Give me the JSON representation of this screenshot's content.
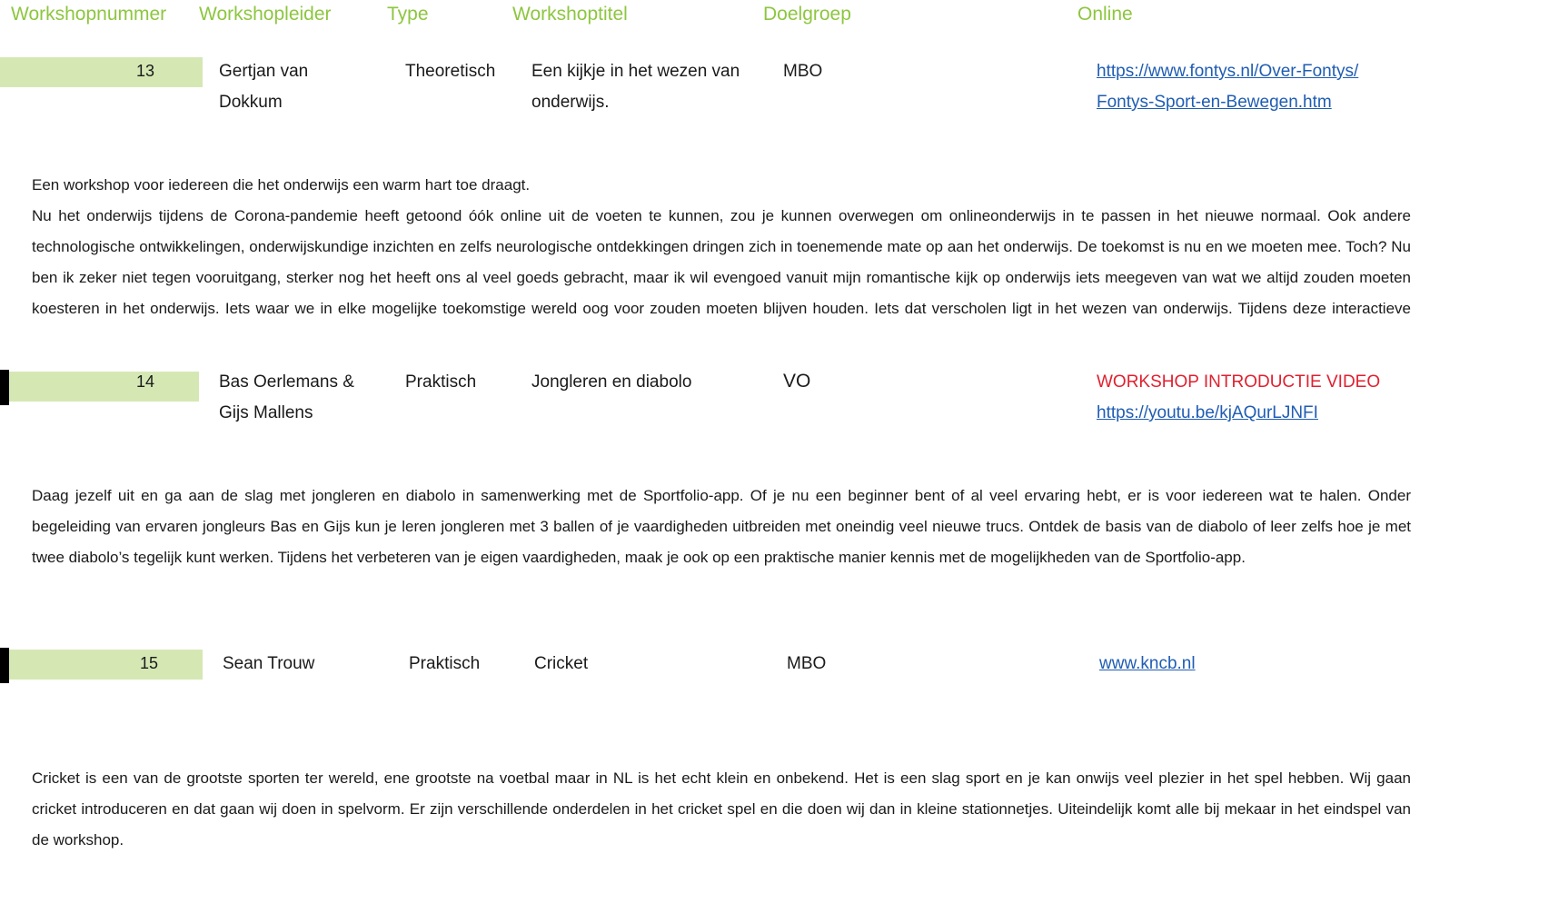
{
  "headers": {
    "nummer": "Workshopnummer",
    "leider": "Workshopleider",
    "type": "Type",
    "titel": "Workshoptitel",
    "doelgroep": "Doelgroep",
    "online": "Online"
  },
  "workshops": [
    {
      "nummer": "13",
      "leider_l1": "Gertjan van",
      "leider_l2": "Dokkum",
      "type": "Theoretisch",
      "titel_l1": "Een kijkje in het wezen van",
      "titel_l2": "onderwijs.",
      "doelgroep": "MBO",
      "link_l1": "https://www.fontys.nl/Over-Fontys/",
      "link_l2": "Fontys-Sport-en-Bewegen.htm",
      "desc_intro": "Een workshop voor iedereen die het onderwijs een warm hart toe draagt.",
      "desc_body": "Nu het onderwijs tijdens de Corona-pandemie heeft getoond óók online uit de voeten te kunnen, zou je kunnen overwegen om onlineonderwijs in te passen in het nieuwe normaal. Ook andere technologische ontwikkelingen, onderwijskundige inzichten en zelfs neurologische ontdekkingen dringen zich in toenemende mate op aan het onderwijs. De toekomst is nu en we moeten mee. Toch? Nu ben ik zeker niet tegen vooruitgang, sterker nog het heeft ons al veel goeds gebracht, maar ik wil evengoed vanuit mijn romantische kijk op onderwijs iets meegeven van wat we altijd zouden moeten koesteren in het onderwijs. Iets waar we in elke mogelijke toekomstige wereld oog voor zouden moeten blijven houden. Iets dat verscholen ligt in het wezen van onderwijs. Tijdens deze interactieve workshop gaan we, na een licht filosofische introductie van het hoofdthema, met elkaar in gesprek over hoe we binnen ons"
    },
    {
      "nummer": "14",
      "leider_l1": "Bas Oerlemans &",
      "leider_l2": "Gijs Mallens",
      "type": "Praktisch",
      "titel": "Jongleren en diabolo",
      "doelgroep": "VO",
      "online_label": "WORKSHOP INTRODUCTIE VIDEO",
      "link": "https://youtu.be/kjAQurLJNFI",
      "desc": "Daag jezelf uit en ga aan de slag met jongleren en diabolo in samenwerking met de Sportfolio-app. Of je nu een beginner bent of al veel ervaring hebt, er is voor iedereen wat te halen. Onder begeleiding van ervaren jongleurs Bas en Gijs kun je leren jongleren met 3 ballen of je vaardigheden uitbreiden met oneindig veel nieuwe trucs. Ontdek de basis van de diabolo of leer zelfs hoe je met twee diabolo’s tegelijk kunt werken. Tijdens het verbeteren van je eigen vaardigheden, maak je ook op een praktische manier kennis met de mogelijkheden van de Sportfolio-app."
    },
    {
      "nummer": "15",
      "leider": "Sean Trouw",
      "type": "Praktisch",
      "titel": "Cricket",
      "doelgroep": "MBO",
      "link": "www.kncb.nl",
      "desc": "Cricket is een van de grootste sporten ter wereld, ene grootste na voetbal maar in NL is het echt klein en onbekend. Het is een slag sport en je kan onwijs veel plezier in het spel hebben. Wij gaan cricket introduceren en dat gaan wij doen in spelvorm. Er zijn verschillende onderdelen in het cricket spel en die doen wij dan in kleine stationnetjes. Uiteindelijk komt alle bij mekaar in het eindspel van de workshop."
    }
  ]
}
